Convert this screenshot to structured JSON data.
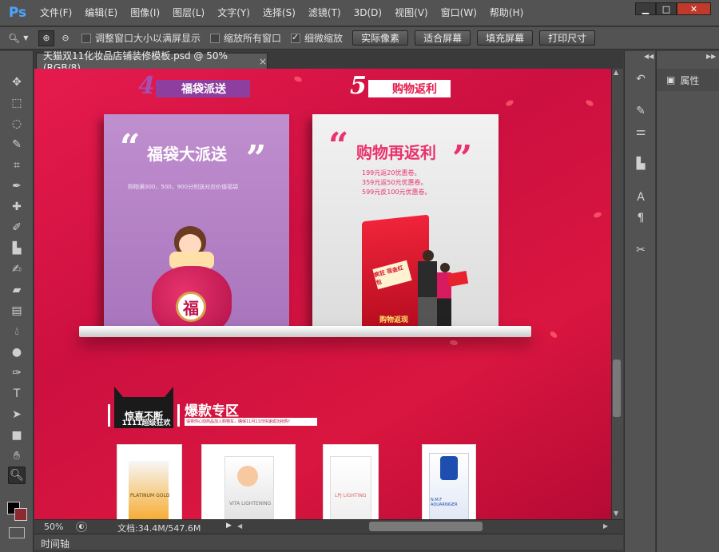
{
  "app": {
    "logo": "Ps",
    "menus": [
      "文件(F)",
      "编辑(E)",
      "图像(I)",
      "图层(L)",
      "文字(Y)",
      "选择(S)",
      "滤镜(T)",
      "3D(D)",
      "视图(V)",
      "窗口(W)",
      "帮助(H)"
    ],
    "window_buttons": [
      "▁",
      "□",
      "✕"
    ]
  },
  "options": {
    "resize_label": "调整窗口大小以满屏显示",
    "zoom_all_label": "缩放所有窗口",
    "scrubby_label": "细微缩放",
    "scrubby_checked": true,
    "buttons": [
      "实际像素",
      "适合屏幕",
      "填充屏幕",
      "打印尺寸"
    ]
  },
  "document": {
    "tab_title": "天猫双11化妆品店铺装修模板.psd @ 50%(RGB/8)",
    "close": "×"
  },
  "canvas": {
    "tag4": {
      "num": "4",
      "text": "福袋派送"
    },
    "tag5": {
      "num": "5",
      "text": "购物返利"
    },
    "card1": {
      "title": "福袋大派送",
      "sub": "购物满300，500，900分别送对应价值福袋",
      "bag_char": "福"
    },
    "card2": {
      "title": "购物再返利",
      "lines": [
        "199元返20优惠卷。",
        "359元返50元优惠卷。",
        "599元反100元优惠卷。"
      ],
      "env1": "购物返现",
      "env2": "疯狂 现金红包"
    },
    "hot": {
      "badge_top": "惊喜不断",
      "badge_bottom": "1111超级狂欢",
      "title": "爆款专区",
      "sub": "请将你心动商品加入购物车，确保11月11日快速成功抢购！"
    },
    "products": [
      "PLATINUM GOLD",
      "VITA LIGHTENING",
      "LPJ LIGHTING",
      "N.M.F AQUARINGER"
    ]
  },
  "status": {
    "zoom": "50%",
    "doc": "文档:34.4M/547.6M"
  },
  "timeline": {
    "label": "时间轴"
  },
  "panels": {
    "properties": "属性"
  },
  "colors": {
    "accent": "#e61b4d",
    "ui_bg": "#535353"
  }
}
